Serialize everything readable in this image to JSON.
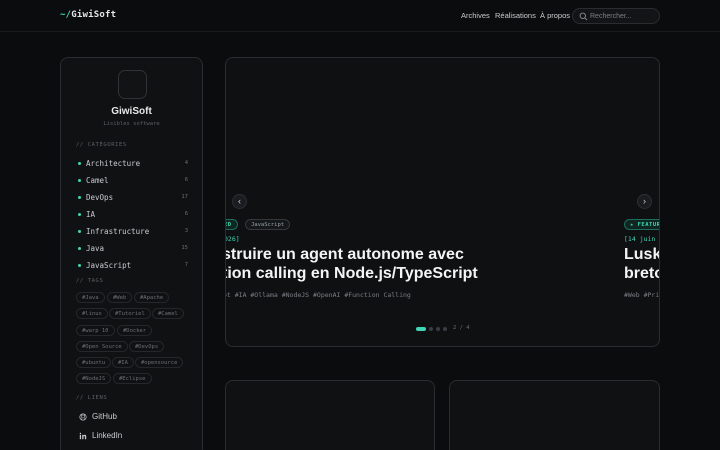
{
  "header": {
    "logo_prefix": "~/",
    "logo_name": "GiwiSoft",
    "nav": [
      "Archives",
      "Réalisations",
      "À propos"
    ],
    "search_placeholder": "Rechercher..."
  },
  "sidebar": {
    "brand": "GiwiSoft",
    "subtitle": "Lisibles software",
    "categories_heading": "// CATÉGORIES",
    "categories": [
      {
        "name": "Architecture",
        "count": "4"
      },
      {
        "name": "Camel",
        "count": "6"
      },
      {
        "name": "DevOps",
        "count": "17"
      },
      {
        "name": "IA",
        "count": "6"
      },
      {
        "name": "Infrastructure",
        "count": "3"
      },
      {
        "name": "Java",
        "count": "15"
      },
      {
        "name": "JavaScript",
        "count": "7"
      }
    ],
    "tags_heading": "// TAGS",
    "tags": [
      "#Java",
      "#Web",
      "#Apache",
      "#linux",
      "#Tutoriel",
      "#Camel",
      "#warp 10",
      "#Docker",
      "#Open Source",
      "#DevOps",
      "#ubuntu",
      "#IA",
      "#opensource",
      "#NodeJS",
      "#Eclipse"
    ],
    "links_heading": "// LIENS",
    "links": [
      {
        "label": "GitHub",
        "icon": "github-icon"
      },
      {
        "label": "LinkedIn",
        "icon": "linkedin-icon"
      }
    ]
  },
  "carousel": {
    "slide_left": {
      "featured": "ED",
      "category": "JavaScript",
      "date": "026]",
      "title_line1": "struire un agent autonome avec",
      "title_line2": "tion calling en Node.js/TypeScript",
      "tags": "pt  #IA  #Ollama  #NodeJS  #OpenAI  #Function Calling"
    },
    "slide_right": {
      "featured": "★ FEATUR",
      "date": "[14 juin 2",
      "title_line1": "Lusk",
      "title_line2": "breto",
      "tags": "#Web  #Pri"
    },
    "pager": "2 / 4",
    "prev_glyph": "‹",
    "next_glyph": "›"
  },
  "accent_color": "#3fd5b6"
}
